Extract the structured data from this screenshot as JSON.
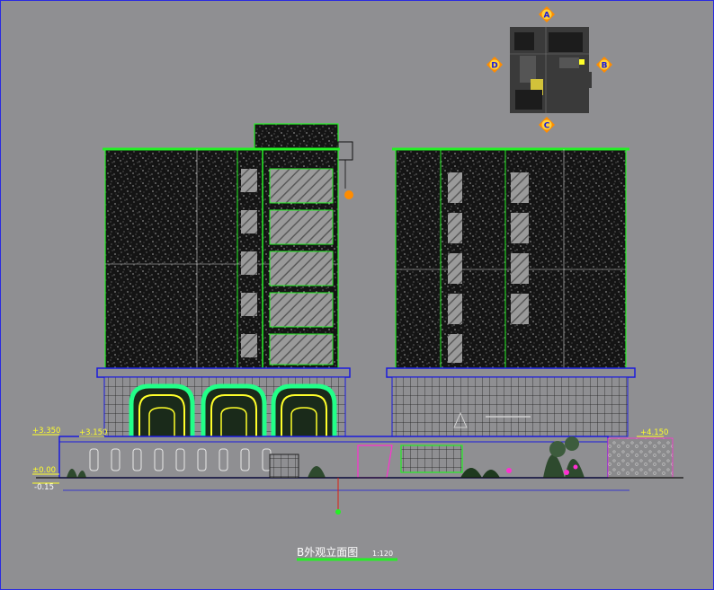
{
  "drawing": {
    "title": "B外观立面图",
    "scale": "1:120"
  },
  "key_plan": {
    "markers": [
      {
        "id": "north",
        "letter": "A"
      },
      {
        "id": "east",
        "letter": "B"
      },
      {
        "id": "south",
        "letter": "C"
      },
      {
        "id": "west",
        "letter": "D"
      }
    ]
  },
  "levels": {
    "left_upper": "+3.350",
    "left_mid": "+3.150",
    "left_zero": "±0.00",
    "left_low": "-0.15",
    "right_upper": "+4.150"
  },
  "colors": {
    "background": "#8f8f92",
    "linework": "#24f024",
    "outline": "#1a1add",
    "hatch_dark": "#151515",
    "label_yellow": "#ffff2a",
    "arch_glow": "#22ff88",
    "accent_orange": "#ff8c00",
    "planting_pink": "#ff2fd1"
  }
}
